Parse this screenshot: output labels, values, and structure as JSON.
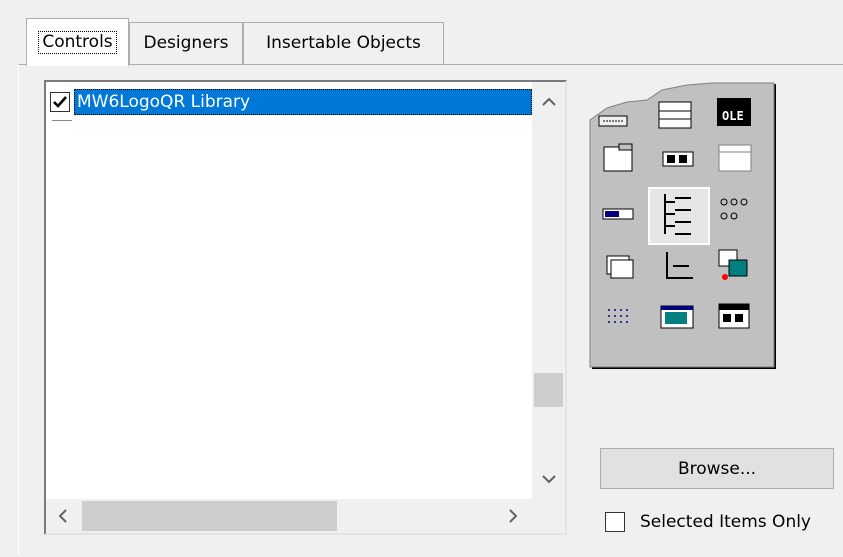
{
  "tabs": [
    {
      "label": "Controls",
      "active": true
    },
    {
      "label": "Designers",
      "active": false
    },
    {
      "label": "Insertable Objects",
      "active": false
    }
  ],
  "list": {
    "items": [
      {
        "label": "MW6LogoQR Library",
        "checked": true,
        "selected": true
      }
    ],
    "scroll_up": "⌃",
    "scroll_down": "⌄",
    "scroll_left": "‹",
    "scroll_right": "›"
  },
  "toolbox": {
    "ole_label": "OLE"
  },
  "browse_label": "Browse...",
  "selected_only": {
    "label": "Selected Items Only",
    "checked": false
  },
  "colors": {
    "selection": "#0078d7",
    "face": "#f0f0f0",
    "border": "#adadad"
  }
}
